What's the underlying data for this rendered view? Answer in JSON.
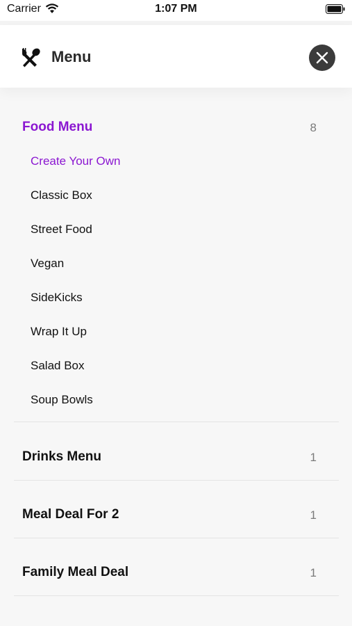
{
  "status_bar": {
    "carrier": "Carrier",
    "time": "1:07 PM"
  },
  "header": {
    "title": "Menu",
    "icon": "cutlery-icon",
    "close_icon": "close-icon"
  },
  "sections": [
    {
      "title": "Food Menu",
      "count": "8",
      "expanded": true,
      "items": [
        "Create Your Own",
        "Classic Box",
        "Street Food",
        "Vegan",
        "SideKicks",
        "Wrap It Up",
        "Salad Box",
        "Soup Bowls"
      ]
    },
    {
      "title": "Drinks Menu",
      "count": "1",
      "expanded": false
    },
    {
      "title": "Meal Deal For 2",
      "count": "1",
      "expanded": false
    },
    {
      "title": "Family Meal Deal",
      "count": "1",
      "expanded": false
    }
  ],
  "colors": {
    "accent": "#8b17d1",
    "close_button_bg": "#3b3b3b"
  }
}
